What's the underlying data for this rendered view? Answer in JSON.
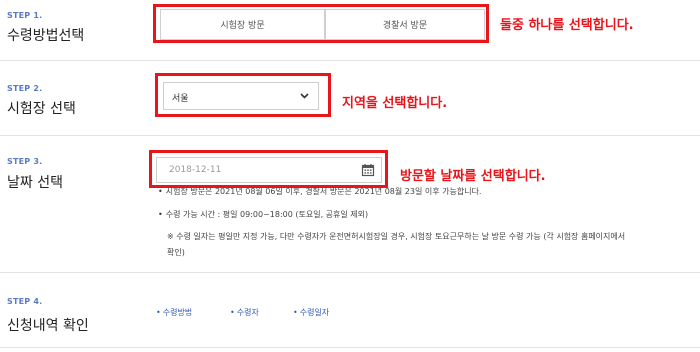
{
  "steps": [
    {
      "label": "STEP 1.",
      "title": "수령방법선택"
    },
    {
      "label": "STEP 2.",
      "title": "시험장 선택"
    },
    {
      "label": "STEP 3.",
      "title": "날짜 선택"
    },
    {
      "label": "STEP 4.",
      "title": "신청내역 확인"
    }
  ],
  "method": {
    "option1": "시험장 방문",
    "option2": "경찰서 방문",
    "annotation": "둘중 하나를 선택합니다."
  },
  "region": {
    "selected": "서울",
    "annotation": "지역을 선택합니다."
  },
  "date": {
    "value": "2018-12-11",
    "annotation": "방문할 날짜를 선택합니다."
  },
  "notes": {
    "bullet": "•",
    "line1": "시험장 방문은 2021년 08월 06일 이후, 경찰서 방문은 2021년 08월 23일 이후 가능합니다.",
    "line2": "수령 가능 시간 : 평일 09:00~18:00 (토요일, 공휴일 제외)",
    "line3a": "※ 수령 일자는 평일만 지정 가능, 다만 수령자가 운전면허시험장일 경우, 시험장 토요근무하는 날 방문 수령 가능 (각 시험장 홈페이지에서",
    "line3b": "확인)"
  },
  "summary": {
    "items": [
      "수령방법",
      "수령자",
      "수령일자"
    ]
  },
  "colors": {
    "accent_red": "#e8151b",
    "step_blue": "#5a79c8",
    "link_blue": "#2f59b8"
  }
}
